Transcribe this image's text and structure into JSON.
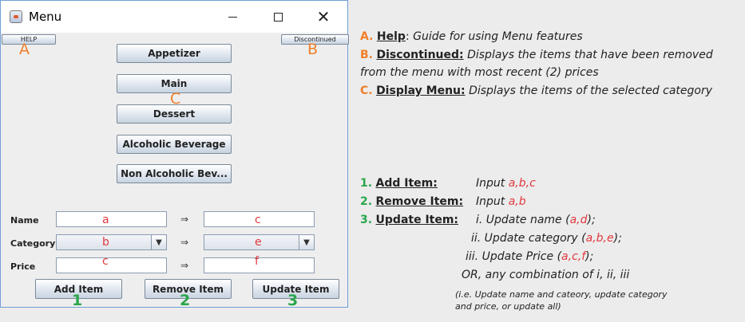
{
  "window": {
    "title": "Menu",
    "buttons": {
      "help": "HELP",
      "discontinued": "Discontinued"
    },
    "categories": [
      "Appetizer",
      "Main",
      "Dessert",
      "Alcoholic Beverage",
      "Non Alcoholic Bev..."
    ],
    "form": {
      "labels": {
        "name": "Name",
        "category": "Category",
        "price": "Price"
      },
      "arrow": "⇒",
      "actions": [
        "Add Item",
        "Remove Item",
        "Update Item"
      ]
    },
    "overlay": {
      "letters": [
        "A",
        "B",
        "C"
      ],
      "numbers": [
        "1",
        "2",
        "3"
      ],
      "field_marks": {
        "name_left": "a",
        "name_right": "c",
        "category_left": "b",
        "category_right": "e",
        "price_left": "c",
        "price_right": "f"
      }
    }
  },
  "annotations": {
    "A": {
      "letter": "A",
      "key": "Help",
      "sep": ":",
      "desc": "Guide for using Menu features"
    },
    "B": {
      "letter": "B",
      "key": "Discontinued:",
      "desc1": "Displays the items that have been removed",
      "desc2": "from the menu with most recent (2) prices"
    },
    "C": {
      "letter": "C",
      "key": "Display Menu:",
      "desc": "Displays the items of the selected category"
    },
    "ops": {
      "add": {
        "num": "1",
        "key": "Add Item:",
        "input": "Input",
        "params": "a,b,c"
      },
      "remove": {
        "num": "2",
        "key": "Remove Item:",
        "input": "Input",
        "params": "a,b"
      },
      "update": {
        "num": "3",
        "key": "Update Item:",
        "i": {
          "pre": "i. Update name (",
          "params": "a,d",
          "post": ");"
        },
        "ii": {
          "pre": "ii. Update category (",
          "params": "a,b,e",
          "post": ");"
        },
        "iii": {
          "pre": "iii. Update Price (",
          "params": "a,c,f",
          "post": ");"
        },
        "or": "OR, any combination of i, ii, iii",
        "note1": "(i.e. Update name and cateory, update category",
        "note2": "and price, or update all)"
      }
    }
  }
}
